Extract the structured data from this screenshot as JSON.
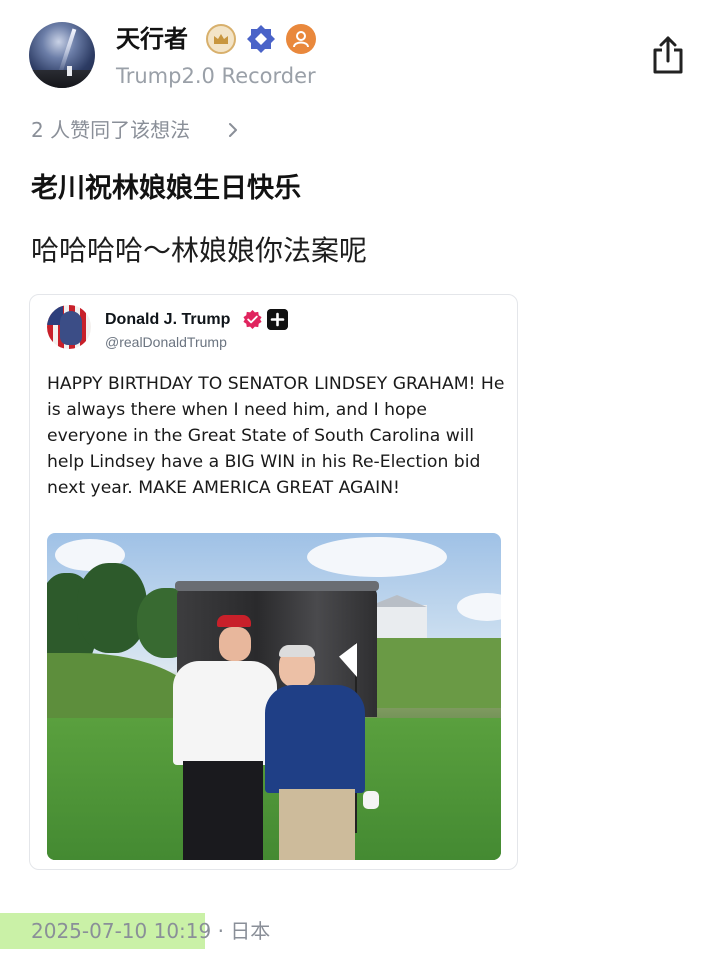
{
  "author": {
    "name": "天行者",
    "subtitle": "Trump2.0 Recorder",
    "badges": [
      "crown-badge-icon",
      "diamond-badge-icon",
      "person-badge-icon"
    ]
  },
  "share_icon": "share-icon",
  "likes": {
    "text": "2 人赞同了该想法",
    "chevron": "chevron-right-icon"
  },
  "post": {
    "title": "老川祝林娘娘生日快乐",
    "body": "哈哈哈哈～林娘娘你法案呢"
  },
  "tweet": {
    "name": "Donald J. Trump",
    "handle": "@realDonaldTrump",
    "verified_icon": "verified-badge-icon",
    "affiliate_icon": "plus-badge-icon",
    "text": "HAPPY BIRTHDAY TO SENATOR LINDSEY GRAHAM! He is always there when I need him, and I hope everyone in the Great State of South Carolina will help Lindsey have a BIG WIN in his Re-Election bid next year. MAKE AMERICA GREAT AGAIN!"
  },
  "meta": {
    "line": "2025-07-10 10:19 · 日本"
  },
  "colors": {
    "accent_verified": "#e0245e",
    "muted_text": "#8a8f98",
    "highlight": "#adea78",
    "badge_diamond": "#4a63c8",
    "badge_person": "#e9883c"
  }
}
